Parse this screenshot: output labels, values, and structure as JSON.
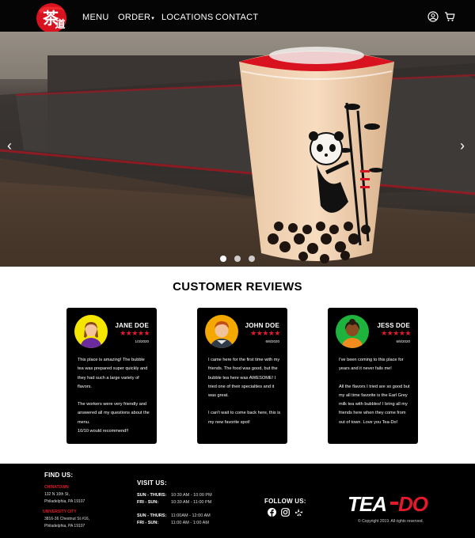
{
  "nav": {
    "items": [
      {
        "label": "MENU"
      },
      {
        "label": "ORDER"
      },
      {
        "label": "LOCATIONS"
      },
      {
        "label": "CONTACT"
      }
    ],
    "order_caret": "▾",
    "icons": [
      "user-circle-icon",
      "shopping-cart-icon"
    ]
  },
  "hero": {
    "prev_arrow": "‹",
    "next_arrow": "›",
    "slide_count": 3,
    "active_slide": 1
  },
  "reviews": {
    "title": "CUSTOMER REVIEWS",
    "cards": [
      {
        "name": "JANE DOE",
        "stars": "★★★★★",
        "date": "1/3/2020",
        "avatar_color": "#f5e600",
        "paragraphs": [
          "This place is amazing! The bubble tea was prepared super quickly and they had such a large variety of flavors.",
          "The workers were very friendly and answered all my questions about the menu.",
          "10/10 would recommend!!"
        ]
      },
      {
        "name": "JOHN DOE",
        "stars": "★★★★★",
        "date": "6/8/2020",
        "avatar_color": "#f5a800",
        "paragraphs": [
          "I came here for the first time with my friends. The food was good, but the bubble tea here was AWESOME! I tried one of their specialties and it was great.",
          "I can't wait to come back here, this is my new favorite spot!"
        ]
      },
      {
        "name": "JESS DOE",
        "stars": "★★★★★",
        "date": "6/8/2020",
        "avatar_color": "#1db33c",
        "paragraphs": [
          "I've been coming to this place for years and it never fails me!",
          "All the flavors I tried are so good but my all time favorite is the Earl Grey milk tea with bubbles! I bring all my friends here when they come from out of town. Love you Tea-Do!"
        ]
      }
    ]
  },
  "footer": {
    "find_title": "FIND US:",
    "locations": [
      {
        "name": "CHINATOWN",
        "line1": "132 N 10th St,",
        "line2": "Philadelphia, PA 19107"
      },
      {
        "name": "UNIVERSITY CITY",
        "line1": "3816-36 Chestnut St #16,",
        "line2": "Philadelphia, PA 19107"
      }
    ],
    "visit_title": "VISIT US:",
    "hours": [
      {
        "day": "SUN - THURS:",
        "time": "10:30 AM - 10:00 PM"
      },
      {
        "day": "FRI - SUN:",
        "time": "10:30 AM - 11:00 PM"
      },
      {
        "day": "SUN - THURS:",
        "time": "11:00AM - 12:00 AM"
      },
      {
        "day": "FRI - SUN:",
        "time": "11:00 AM - 1:00 AM"
      }
    ],
    "follow_title": "FOLLOW US:",
    "social_icons": [
      "facebook-icon",
      "instagram-icon",
      "yelp-icon"
    ],
    "brand_text": "TEA-DO",
    "copyright": "© Copyright 2019. All rights reserved."
  },
  "colors": {
    "accent_red": "#e21a2b",
    "nav_bg": "#050505",
    "card_bg": "#000000"
  }
}
